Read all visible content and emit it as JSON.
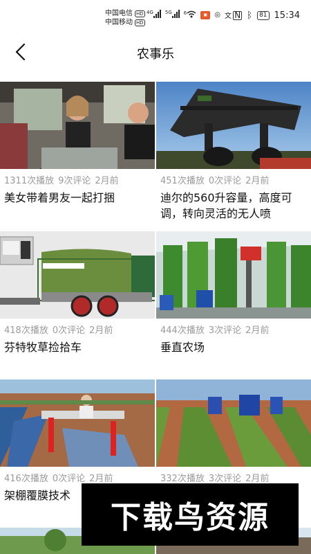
{
  "status_bar": {
    "carrier1": "中国电信",
    "carrier2": "中国移动",
    "hd": "HD",
    "net1": "4G",
    "net2": "5G",
    "net3": "6",
    "battery": "81",
    "time": "15:34"
  },
  "header": {
    "title": "农事乐"
  },
  "videos": [
    {
      "plays": "1311次播放",
      "comments": "9次评论",
      "age": "2月前",
      "title": "美女带着男友一起打捆"
    },
    {
      "plays": "451次播放",
      "comments": "0次评论",
      "age": "2月前",
      "title": "迪尔的560升容量，高度可调，转向灵活的无人喷"
    },
    {
      "plays": "418次播放",
      "comments": "0次评论",
      "age": "2月前",
      "title": "芬特牧草捡拾车"
    },
    {
      "plays": "444次播放",
      "comments": "3次评论",
      "age": "2月前",
      "title": "垂直农场"
    },
    {
      "plays": "416次播放",
      "comments": "0次评论",
      "age": "2月前",
      "title": "架棚覆膜技术"
    },
    {
      "plays": "332次播放",
      "comments": "3次评论",
      "age": "2月前",
      "title": ""
    }
  ],
  "watermark": {
    "text": "下载鸟资源"
  }
}
